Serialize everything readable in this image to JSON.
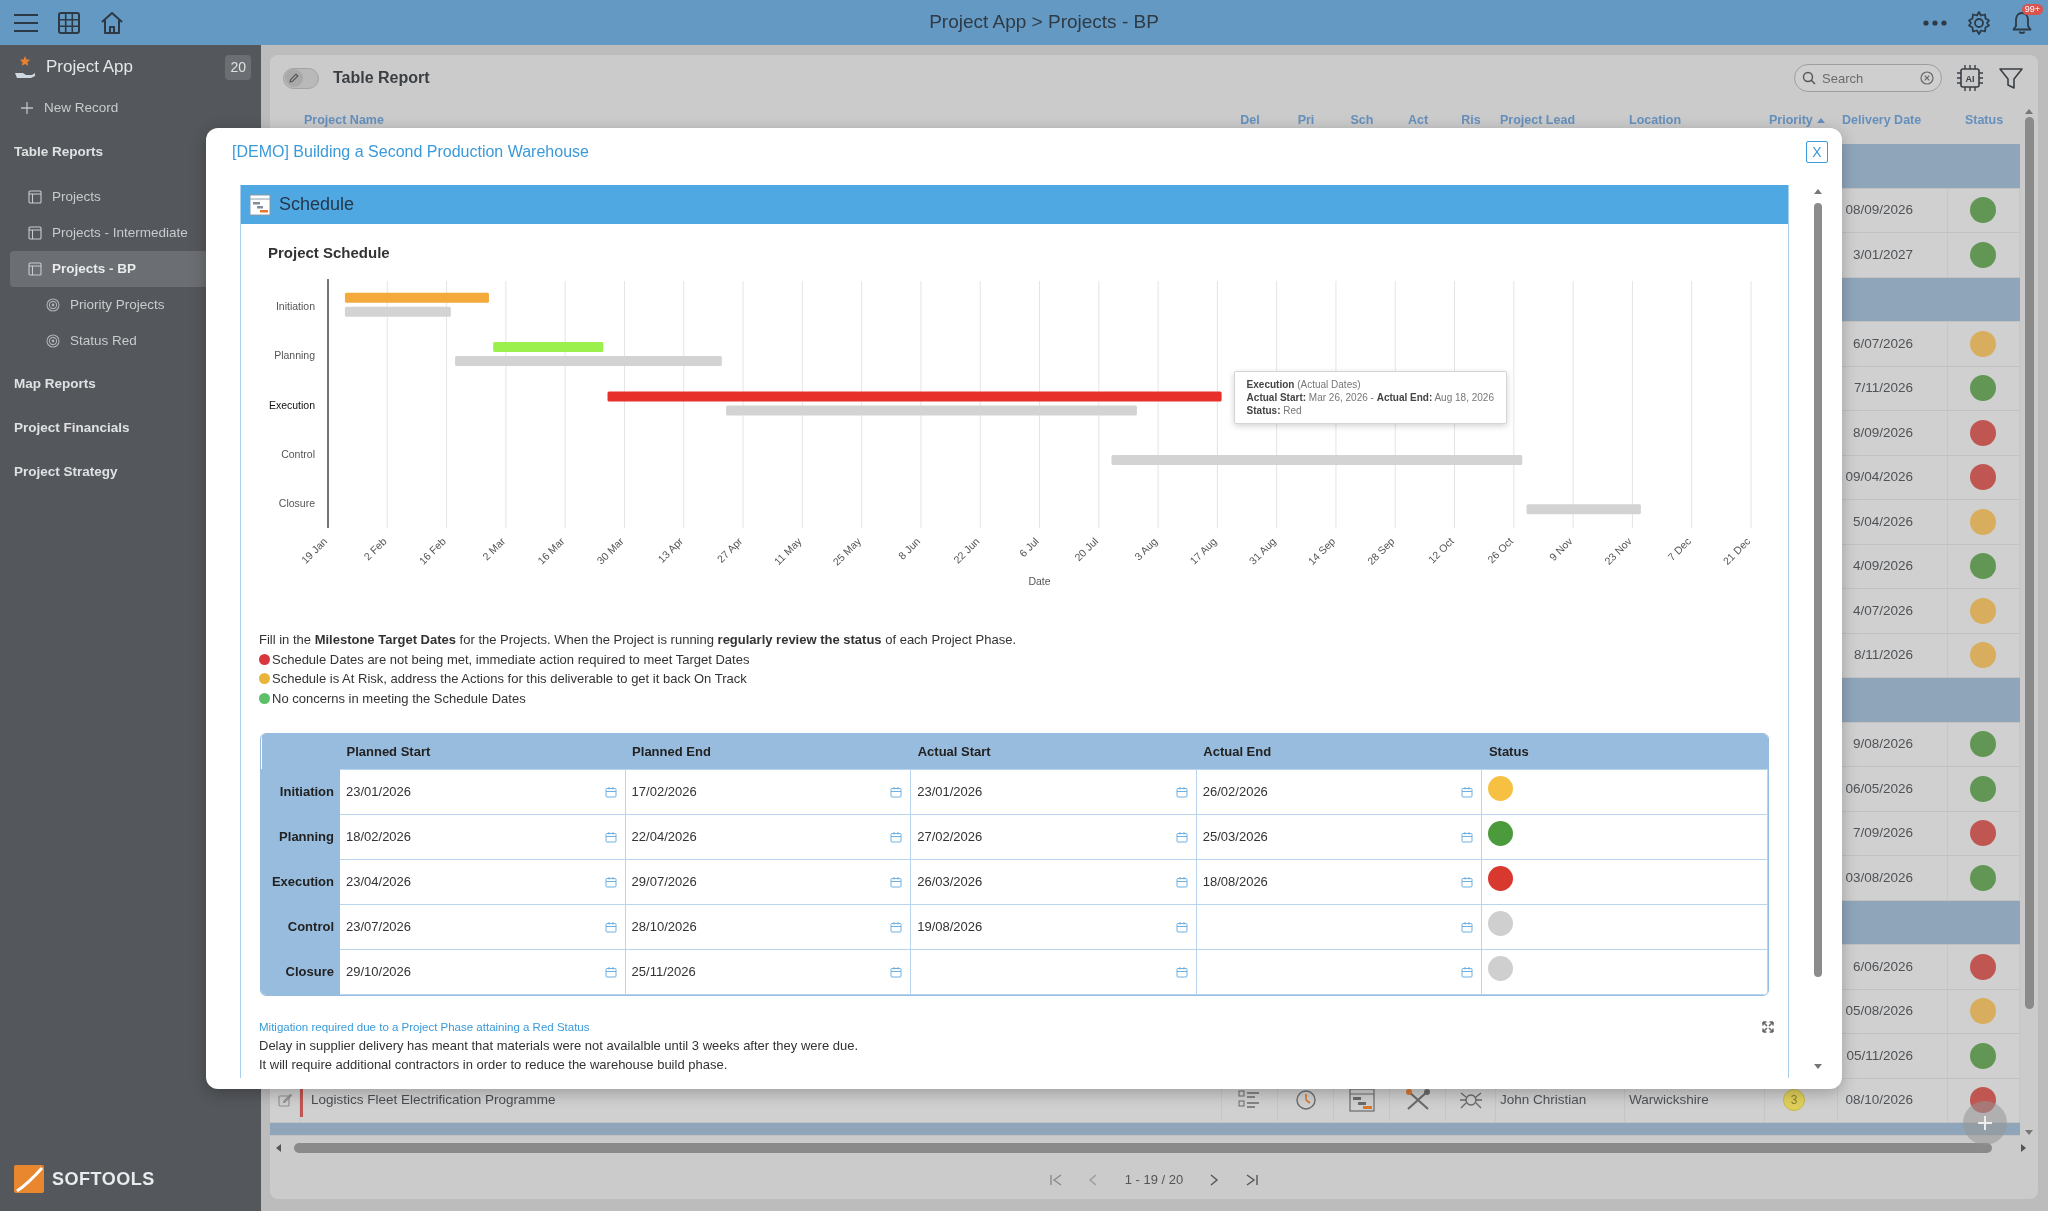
{
  "top_bar": {
    "title": "Project App > Projects - BP",
    "notification_badge": "99+"
  },
  "sidebar": {
    "app_name": "Project App",
    "badge": "20",
    "new_record": "New Record",
    "sections": [
      {
        "label": "Table Reports",
        "items": [
          {
            "label": "Projects",
            "selected": false
          },
          {
            "label": "Projects - Intermediate",
            "selected": false
          },
          {
            "label": "Projects - BP",
            "selected": true,
            "children": [
              {
                "label": "Priority Projects",
                "selected": false
              },
              {
                "label": "Status Red",
                "selected": false
              }
            ]
          }
        ]
      },
      {
        "label": "Map Reports"
      },
      {
        "label": "Project Financials"
      },
      {
        "label": "Project Strategy"
      }
    ],
    "brand": "SOFTOOLS"
  },
  "report": {
    "title": "Table Report",
    "edit_toggle": {
      "on": false
    },
    "search": {
      "placeholder": "Search"
    },
    "ai_label": "AI",
    "columns": [
      {
        "label": "Project Name",
        "sorted": false
      },
      {
        "label": "Del",
        "sorted": false
      },
      {
        "label": "Pri",
        "sorted": false
      },
      {
        "label": "Sch",
        "sorted": false
      },
      {
        "label": "Act",
        "sorted": false
      },
      {
        "label": "Ris",
        "sorted": false
      },
      {
        "label": "Project Lead",
        "sorted": false
      },
      {
        "label": "Location",
        "sorted": false
      },
      {
        "label": "Priority",
        "sorted": true
      },
      {
        "label": "Delivery Date",
        "sorted": false
      },
      {
        "label": "Status",
        "sorted": false
      }
    ],
    "rows": [
      {
        "kind": "group"
      },
      {
        "kind": "record",
        "delivery_date": "08/09/2026",
        "color": "#629655"
      },
      {
        "kind": "record",
        "delivery_date": "3/01/2027",
        "color": "#629655"
      },
      {
        "kind": "group"
      },
      {
        "kind": "record",
        "delivery_date": "6/07/2026",
        "color": "#d8ae5e"
      },
      {
        "kind": "record",
        "delivery_date": "7/11/2026",
        "color": "#629655"
      },
      {
        "kind": "record",
        "delivery_date": "8/09/2026",
        "color": "#bf5651"
      },
      {
        "kind": "record",
        "delivery_date": "09/04/2026",
        "color": "#bf5651"
      },
      {
        "kind": "record",
        "delivery_date": "5/04/2026",
        "color": "#d8ae5e"
      },
      {
        "kind": "record",
        "delivery_date": "4/09/2026",
        "color": "#629655"
      },
      {
        "kind": "record",
        "delivery_date": "4/07/2026",
        "color": "#d8ae5e"
      },
      {
        "kind": "record",
        "delivery_date": "8/11/2026",
        "color": "#d8ae5e"
      },
      {
        "kind": "group"
      },
      {
        "kind": "record",
        "delivery_date": "9/08/2026",
        "color": "#629655"
      },
      {
        "kind": "record",
        "delivery_date": "06/05/2026",
        "color": "#629655"
      },
      {
        "kind": "record",
        "delivery_date": "7/09/2026",
        "color": "#bf5651"
      },
      {
        "kind": "record",
        "delivery_date": "03/08/2026",
        "color": "#629655"
      },
      {
        "kind": "group"
      },
      {
        "kind": "record",
        "delivery_date": "6/06/2026",
        "color": "#bf5651"
      },
      {
        "kind": "record",
        "delivery_date": "05/08/2026",
        "color": "#d8ae5e"
      },
      {
        "kind": "record",
        "delivery_date": "05/11/2026",
        "color": "#629655"
      },
      {
        "kind": "record",
        "project_name": "Logistics Fleet Electrification Programme",
        "project_lead": "John Christian",
        "location": "Warwickshire",
        "priority": "3",
        "delivery_date": "08/10/2026",
        "color": "#bf5651"
      },
      {
        "kind": "group"
      }
    ],
    "pagination": "1 - 19 / 20"
  },
  "modal": {
    "title": "[DEMO] Building a Second Production Warehouse",
    "close_label": "X",
    "section_title": "Schedule",
    "chart": {
      "title": "Project Schedule",
      "xlabel": "Date",
      "categories": [
        "Initiation",
        "Planning",
        "Execution",
        "Control",
        "Closure"
      ],
      "xticks": [
        "19 Jan",
        "2 Feb",
        "16 Feb",
        "2 Mar",
        "16 Mar",
        "30 Mar",
        "13 Apr",
        "27 Apr",
        "11 May",
        "25 May",
        "8 Jun",
        "22 Jun",
        "6 Jul",
        "20 Jul",
        "3 Aug",
        "17 Aug",
        "31 Aug",
        "14 Sep",
        "28 Sep",
        "12 Oct",
        "26 Oct",
        "9 Nov",
        "23 Nov",
        "7 Dec",
        "21 Dec"
      ],
      "tooltip": [
        "**Execution** (Actual Dates)",
        "**Actual Start:** Mar 26, 2026 - **Actual End:** Aug 18, 2026",
        "**Status:** Red"
      ],
      "actual_bars": [
        {
          "color": "#f4a93b"
        },
        {
          "color": "#9bf04b"
        },
        {
          "color": "#e8302a"
        }
      ]
    },
    "intro": "Fill in the **Milestone Target Dates** for the Projects. When the Project is running **regularly review the status** of each Project Phase.",
    "legend": [
      {
        "text": "Schedule Dates are not being met, immediate action required to meet Target Dates",
        "color": "#d9363e"
      },
      {
        "text": "Schedule is At Risk, address the Actions for this deliverable to get it back On Track",
        "color": "#e8b53a"
      },
      {
        "text": "No concerns in meeting the Schedule Dates",
        "color": "#5cc068"
      }
    ],
    "table": {
      "columns": [
        "Planned Start",
        "Planned End",
        "Actual Start",
        "Actual End",
        "Status"
      ],
      "rows": [
        {
          "phase": "Initiation",
          "planned_start": "23/01/2026",
          "planned_end": "17/02/2026",
          "actual_start": "23/01/2026",
          "actual_end": "26/02/2026",
          "color": "#f6c143",
          "hovered": false
        },
        {
          "phase": "Planning",
          "planned_start": "18/02/2026",
          "planned_end": "22/04/2026",
          "actual_start": "27/02/2026",
          "actual_end": "25/03/2026",
          "color": "#4b9b3c",
          "hovered": false
        },
        {
          "phase": "Execution",
          "planned_start": "23/04/2026",
          "planned_end": "29/07/2026",
          "actual_start": "26/03/2026",
          "actual_end": "18/08/2026",
          "color": "#d9382f",
          "hovered": true
        },
        {
          "phase": "Control",
          "planned_start": "23/07/2026",
          "planned_end": "28/10/2026",
          "actual_start": "19/08/2026",
          "color": "#cfcfcf",
          "hovered": false
        },
        {
          "phase": "Closure",
          "planned_start": "29/10/2026",
          "planned_end": "25/11/2026",
          "color": "#cfcfcf",
          "hovered": false
        }
      ]
    },
    "mitigation": {
      "label": "Mitigation required due to a Project Phase attaining a Red Status",
      "lines": [
        "Delay in supplier delivery has meant that materials were not availalble until 3 weeks after they were due.",
        "It will require additional contractors in order to reduce the warehouse build phase."
      ]
    }
  }
}
